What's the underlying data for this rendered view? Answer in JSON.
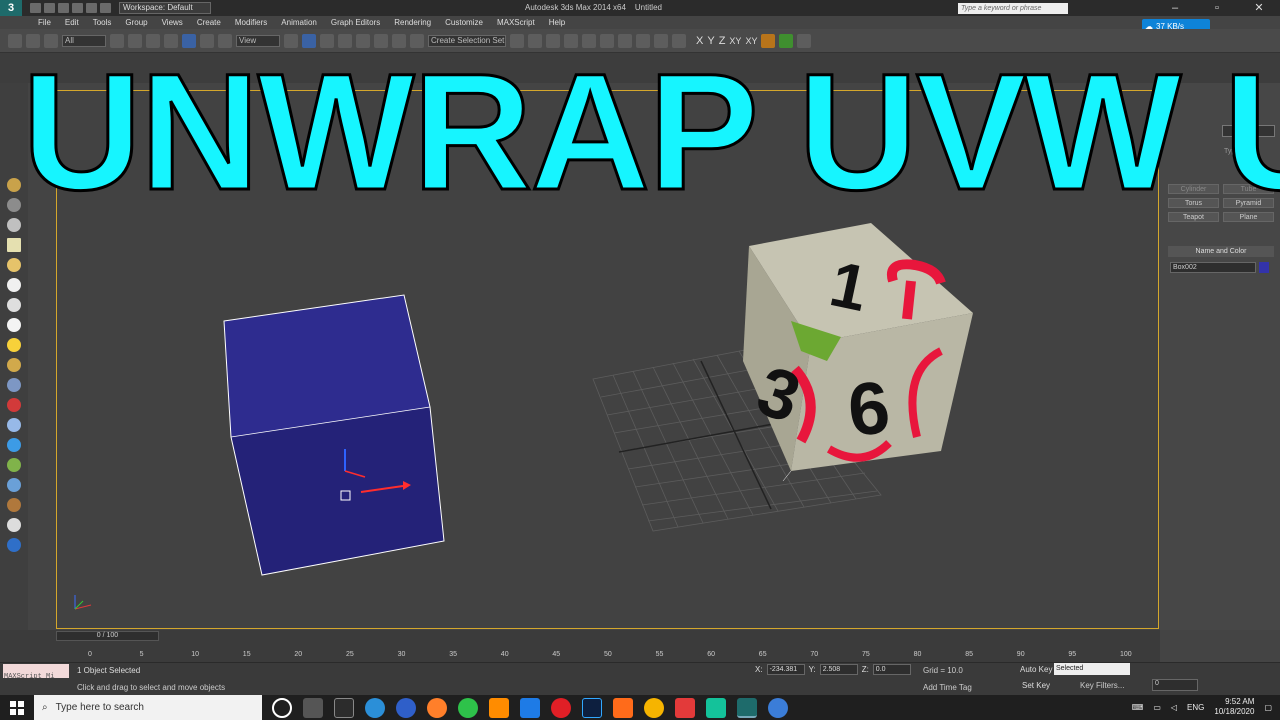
{
  "app": {
    "logo": "3",
    "title": "Autodesk 3ds Max  2014 x64",
    "document": "Untitled",
    "workspace": "Workspace: Default",
    "search_placeholder": "Type a keyword or phrase"
  },
  "menu": [
    "File",
    "Edit",
    "Tools",
    "Group",
    "Views",
    "Create",
    "Modifiers",
    "Animation",
    "Graph Editors",
    "Rendering",
    "Customize",
    "MAXScript",
    "Help"
  ],
  "toolbar": {
    "filter": "All",
    "view": "View",
    "selection_set": "Create Selection Set",
    "axes": [
      "X",
      "Y",
      "Z",
      "XY",
      "XY"
    ]
  },
  "net_speed": "37 KB/s",
  "overlay_title": "UNWRAP UVW USE",
  "command_panel": {
    "type_header": "Type",
    "buttons": [
      "Cylinder",
      "Tube",
      "Torus",
      "Pyramid",
      "Teapot",
      "Plane"
    ],
    "name_color_header": "Name and Color",
    "object_name": "Box002",
    "object_color": "#3333aa"
  },
  "timeline": {
    "slider": "0 / 100",
    "ticks": [
      "0",
      "5",
      "10",
      "15",
      "20",
      "25",
      "30",
      "35",
      "40",
      "45",
      "50",
      "55",
      "60",
      "65",
      "70",
      "75",
      "80",
      "85",
      "90",
      "95",
      "100"
    ]
  },
  "status": {
    "maxscript": "MAXScript Mi",
    "selected": "1 Object Selected",
    "prompt": "Click and drag to select and move objects",
    "x_label": "X:",
    "x": "-234.381",
    "y_label": "Y:",
    "y": "2.508",
    "z_label": "Z:",
    "z": "0.0",
    "grid": "Grid = 10.0",
    "add_time_tag": "Add Time Tag",
    "auto_key": "Auto Key",
    "set_key": "Set Key",
    "selected_dd": "Selected",
    "key_filters": "Key Filters...",
    "frame": "0"
  },
  "cube_numbers": [
    "1",
    "6",
    "3"
  ],
  "taskbar": {
    "search": "Type here to search",
    "lang": "ENG",
    "time": "9:52 AM",
    "date": "10/18/2020"
  }
}
